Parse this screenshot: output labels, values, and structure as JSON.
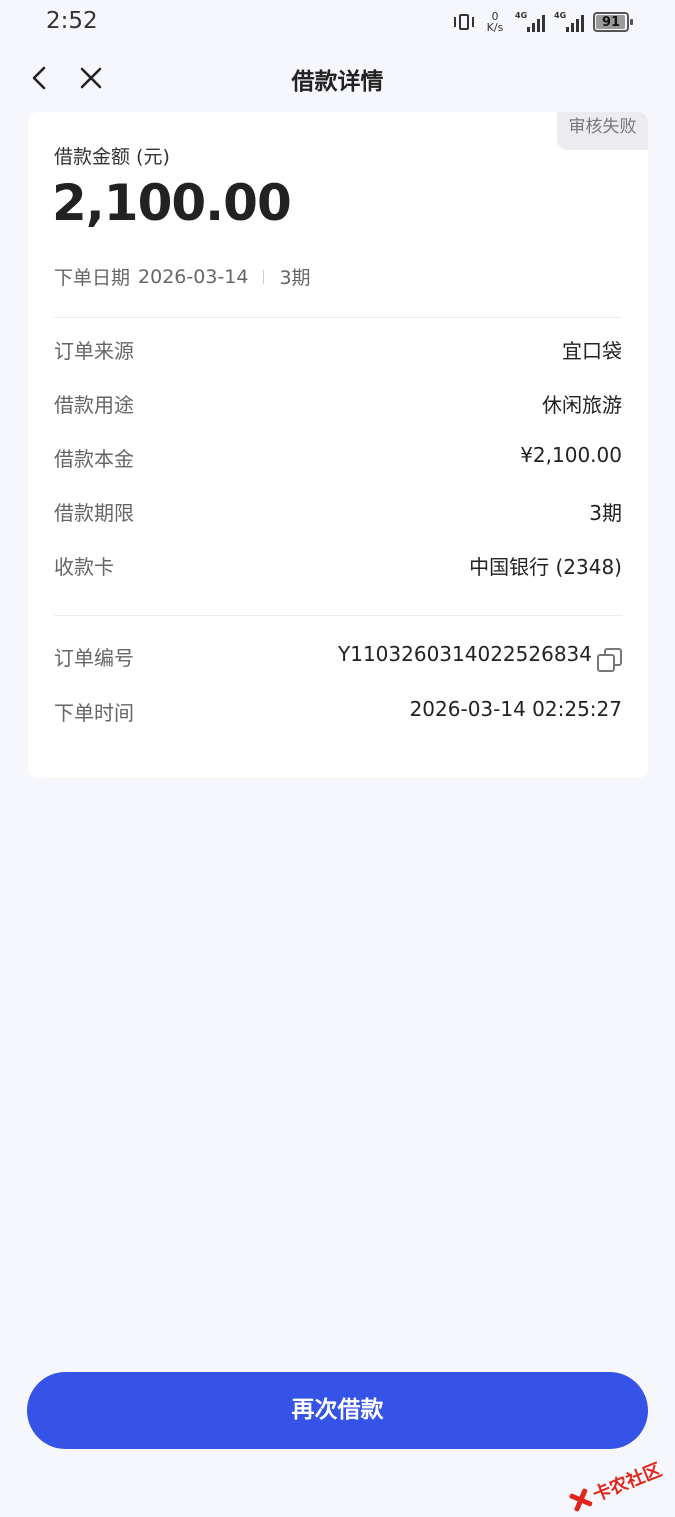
{
  "status_bar": {
    "time": "2:52",
    "net_speed_value": "0",
    "net_speed_unit": "K/s",
    "signal1_tag": "4G",
    "signal2_tag": "4G",
    "battery": "91"
  },
  "nav": {
    "title": "借款详情"
  },
  "card": {
    "status_badge": "审核失败",
    "amount_label": "借款金额 (元)",
    "amount_value": "2,100.00",
    "order_date_label": "下单日期",
    "order_date": "2026-03-14",
    "term_short": "3期",
    "details": [
      {
        "label": "订单来源",
        "value": "宜口袋"
      },
      {
        "label": "借款用途",
        "value": "休闲旅游"
      },
      {
        "label": "借款本金",
        "value": "¥2,100.00"
      },
      {
        "label": "借款期限",
        "value": "3期"
      },
      {
        "label": "收款卡",
        "value": "中国银行 (2348)"
      }
    ],
    "order_no_label": "订单编号",
    "order_no": "Y1103260314022526834",
    "order_time_label": "下单时间",
    "order_time": "2026-03-14 02:25:27"
  },
  "actions": {
    "retry_label": "再次借款"
  },
  "watermark": {
    "text": "卡农社区"
  },
  "colors": {
    "accent": "#3553e6",
    "background": "#f6f7fc",
    "watermark": "#e1251b"
  }
}
